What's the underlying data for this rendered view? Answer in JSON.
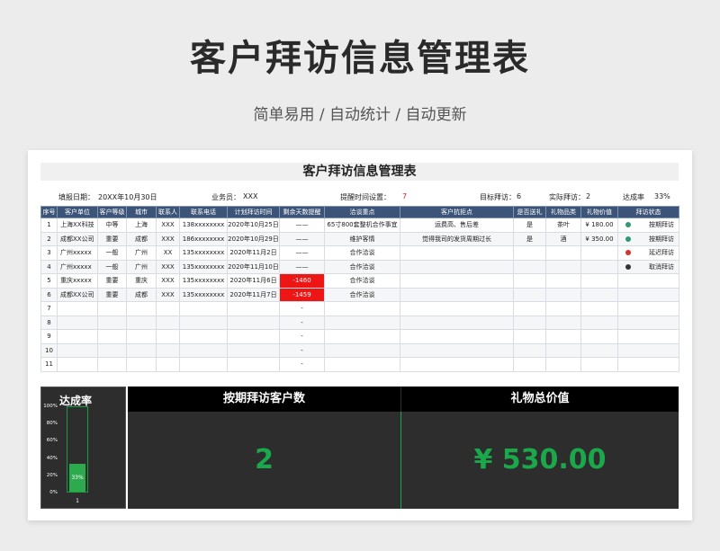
{
  "main_title": "客户拜访信息管理表",
  "subtitle": "简单易用  /  自动统计  /  自动更新",
  "sheet": {
    "title": "客户拜访信息管理表",
    "fill_date_label": "填报日期：",
    "fill_date": "20XX年10月30日",
    "staff_label": "业务员：",
    "staff": "XXX",
    "reminder_label": "提醒时间设置：",
    "reminder": "7",
    "target_label": "目标拜访：",
    "target": "6",
    "actual_label": "实际拜访：",
    "actual": "2",
    "rate_label": "达成率",
    "rate": "33%",
    "columns": [
      "序号",
      "客户单位",
      "客户等级",
      "城市",
      "联系人",
      "联系电话",
      "计划拜访时间",
      "剩余天数提醒",
      "洽谈重点",
      "客户抗拒点",
      "是否送礼",
      "礼物品类",
      "礼物价值",
      "拜访状态"
    ],
    "rows": [
      {
        "no": "1",
        "company": "上海XX科技",
        "level": "中等",
        "city": "上海",
        "contact": "XXX",
        "phone": "138xxxxxxxx",
        "date": "2020年10月25日",
        "remain": "——",
        "focus": "65寸800套整机合作事宜",
        "objection": "运费高、售后差",
        "gift": "是",
        "gift_type": "茶叶",
        "gift_value": "¥    180.00",
        "status": "按期拜访",
        "status_color": "#2e9a72"
      },
      {
        "no": "2",
        "company": "成都XX公司",
        "level": "重要",
        "city": "成都",
        "contact": "XXX",
        "phone": "186xxxxxxxx",
        "date": "2020年10月29日",
        "remain": "——",
        "focus": "维护客情",
        "objection": "觉得我司的发货周期过长",
        "gift": "是",
        "gift_type": "酒",
        "gift_value": "¥    350.00",
        "status": "按期拜访",
        "status_color": "#2e9a72"
      },
      {
        "no": "3",
        "company": "广州xxxxx",
        "level": "一般",
        "city": "广州",
        "contact": "XX",
        "phone": "135xxxxxxxx",
        "date": "2020年11月2日",
        "remain": "——",
        "focus": "合作洽谈",
        "objection": "",
        "gift": "",
        "gift_type": "",
        "gift_value": "",
        "status": "延迟拜访",
        "status_color": "#d9302a"
      },
      {
        "no": "4",
        "company": "广州xxxxx",
        "level": "一般",
        "city": "广州",
        "contact": "XXX",
        "phone": "135xxxxxxxx",
        "date": "2020年11月10日",
        "remain": "——",
        "focus": "合作洽谈",
        "objection": "",
        "gift": "",
        "gift_type": "",
        "gift_value": "",
        "status": "取消拜访",
        "status_color": "#333333"
      },
      {
        "no": "5",
        "company": "重庆xxxxx",
        "level": "重要",
        "city": "重庆",
        "contact": "XXX",
        "phone": "135xxxxxxxx",
        "date": "2020年11月6日",
        "remain": "-1460",
        "remain_neg": true,
        "focus": "合作洽谈",
        "objection": "",
        "gift": "",
        "gift_type": "",
        "gift_value": "",
        "status": "",
        "status_color": ""
      },
      {
        "no": "6",
        "company": "成都XX公司",
        "level": "重要",
        "city": "成都",
        "contact": "XXX",
        "phone": "135xxxxxxxx",
        "date": "2020年11月7日",
        "remain": "-1459",
        "remain_neg": true,
        "focus": "合作洽谈",
        "objection": "",
        "gift": "",
        "gift_type": "",
        "gift_value": "",
        "status": "",
        "status_color": ""
      },
      {
        "no": "7",
        "remain": "-"
      },
      {
        "no": "8",
        "remain": "-"
      },
      {
        "no": "9",
        "remain": "-"
      },
      {
        "no": "10",
        "remain": "-"
      },
      {
        "no": "11",
        "remain": "-"
      }
    ]
  },
  "dashboard": {
    "rate_title": "达成率",
    "rate_value": 0.33,
    "rate_text": "33%",
    "y_ticks": [
      "100%",
      "80%",
      "60%",
      "40%",
      "20%",
      "0%"
    ],
    "x_label": "1",
    "on_time_title": "按期拜访客户数",
    "on_time_value": "2",
    "gift_total_title": "礼物总价值",
    "gift_total_value": "¥ 530.00"
  }
}
